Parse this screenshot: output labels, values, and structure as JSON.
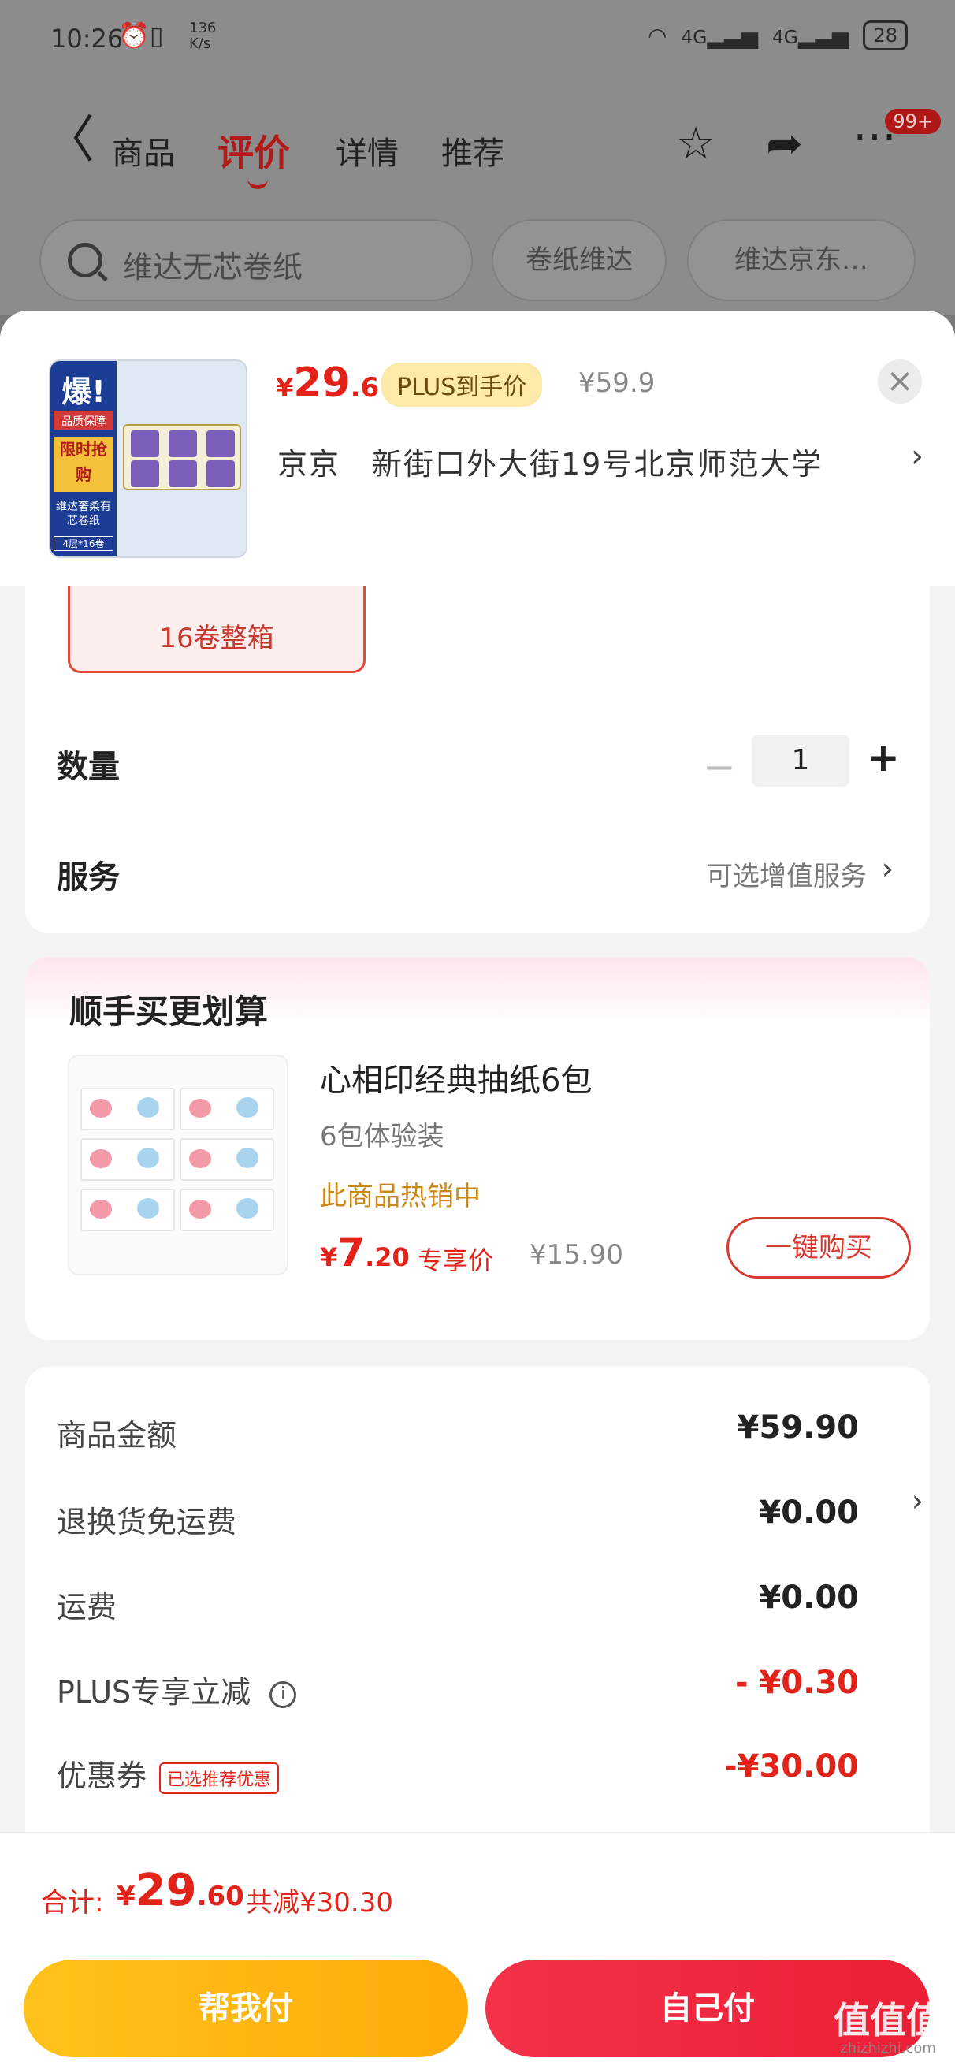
{
  "status_bar": {
    "time": "10:26",
    "speed_value": "136",
    "speed_unit": "K/s",
    "network_1": "4G",
    "network_2": "4G",
    "battery": "28"
  },
  "nav": {
    "tabs": [
      "商品",
      "评价",
      "详情",
      "推荐"
    ],
    "active_tab": "评价",
    "badge": "99+"
  },
  "search": {
    "placeholder": "维达无芯卷纸",
    "chips": [
      "卷纸维达",
      "维达京东…"
    ]
  },
  "product": {
    "price_symbol": "¥",
    "price_int": "29",
    "price_dec": ".6",
    "plus_badge": "PLUS到手价",
    "original_price": "¥59.9",
    "address": "京京　新街口外大街19号北京师范大学",
    "thumb_burst": "爆!",
    "thumb_guarantee": "品质保障",
    "thumb_flash": "限时抢购",
    "thumb_desc": "维达奢柔有芯卷纸",
    "thumb_spec": "4层*16卷"
  },
  "spec": {
    "selected": "16卷整箱"
  },
  "quantity": {
    "label": "数量",
    "value": "1"
  },
  "service": {
    "label": "服务",
    "hint": "可选增值服务"
  },
  "bundle": {
    "title": "顺手买更划算",
    "name": "心相印经典抽纸6包",
    "spec": "6包体验装",
    "hot": "此商品热销中",
    "price_symbol": "¥",
    "price_int": "7",
    "price_dec": ".20",
    "price_label": "专享价",
    "original_price": "¥15.90",
    "buy_label": "一键购买"
  },
  "summary": {
    "rows": [
      {
        "label": "商品金额",
        "value": "¥59.90"
      },
      {
        "label": "退换货免运费",
        "value": "¥0.00"
      },
      {
        "label": "运费",
        "value": "¥0.00"
      },
      {
        "label": "PLUS专享立减",
        "value": "- ¥0.30"
      },
      {
        "label": "优惠券",
        "value": "-¥30.00"
      }
    ],
    "coupon_tag": "已选推荐优惠"
  },
  "footer": {
    "total_label": "合计:",
    "total_symbol": "¥",
    "total_int": "29",
    "total_dec": ".60",
    "saved": "共减¥30.30",
    "help_pay": "帮我付",
    "self_pay": "自己付"
  },
  "watermark": {
    "main": "值值值",
    "sub": "zhizhizhi.com"
  },
  "colors": {
    "accent_red": "#e2231a",
    "plus_gold": "#fde9a8",
    "help_pay_yellow": "#ffb712",
    "self_pay_red": "#ef283f"
  }
}
